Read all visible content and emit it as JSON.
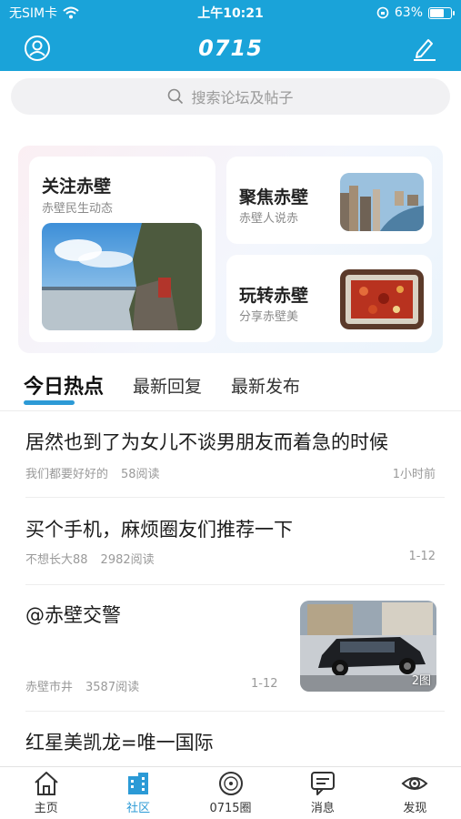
{
  "status_bar": {
    "carrier": "无SIM卡",
    "time": "上午10:21",
    "battery": "63%",
    "battery_level": 0.63
  },
  "nav": {
    "title": "0715"
  },
  "search": {
    "placeholder": "搜索论坛及帖子"
  },
  "cards": {
    "focus": {
      "title": "关注赤壁",
      "subtitle": "赤壁民生动态"
    },
    "spotlight": {
      "title": "聚焦赤壁",
      "subtitle": "赤壁人说赤"
    },
    "fun": {
      "title": "玩转赤壁",
      "subtitle": "分享赤壁美"
    }
  },
  "tabs": [
    {
      "label": "今日热点",
      "active": true
    },
    {
      "label": "最新回复"
    },
    {
      "label": "最新发布"
    }
  ],
  "posts": [
    {
      "title": "居然也到了为女儿不谈男朋友而着急的时候",
      "author": "我们都要好好的",
      "reads": "58阅读",
      "time": "1小时前"
    },
    {
      "title": "买个手机，麻烦圈友们推荐一下",
      "author": "不想长大88",
      "reads": "2982阅读",
      "time": "1-12"
    },
    {
      "title": "@赤壁交警",
      "author": "赤壁市井",
      "reads": "3587阅读",
      "time": "1-12",
      "image_count": "2图"
    },
    {
      "title": "红星美凯龙=唯一国际"
    }
  ],
  "tab_bar": [
    {
      "label": "主页",
      "icon": "home-icon"
    },
    {
      "label": "社区",
      "icon": "community-icon",
      "active": true
    },
    {
      "label": "0715圈",
      "icon": "circle-icon"
    },
    {
      "label": "消息",
      "icon": "message-icon"
    },
    {
      "label": "发现",
      "icon": "discover-icon"
    }
  ],
  "colors": {
    "primary": "#1aa3d9",
    "accent": "#2b9ad6"
  }
}
